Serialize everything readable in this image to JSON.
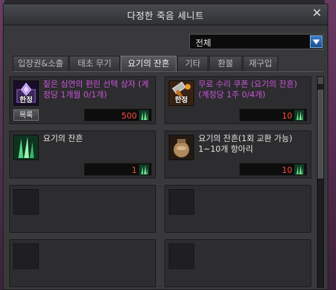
{
  "window": {
    "title": "다정한 죽음 세니트",
    "close_icon": "close-icon"
  },
  "filter": {
    "selected": "전체",
    "dropdown_icon": "chevron-down-icon"
  },
  "tabs": [
    {
      "label": "입장권&소출",
      "active": false
    },
    {
      "label": "태초 무기",
      "active": false
    },
    {
      "label": "요기의 잔흔",
      "active": true
    },
    {
      "label": "기타",
      "active": false
    },
    {
      "label": "환불",
      "active": false
    },
    {
      "label": "재구입",
      "active": false
    }
  ],
  "items": [
    {
      "name": "짙은 심연의 편린 선택 상자 (계정당 1개월 0/1개)",
      "name_color": "#cc55dd",
      "price": "500",
      "price_color": "#ff4a3a",
      "badge": "한정",
      "list_button": "목록",
      "icon": "purple-crystal-box-icon"
    },
    {
      "name": "무료 수리 쿠폰 (요기의 잔흔) (계정당 1주 0/4개)",
      "name_color": "#cc55dd",
      "price": "10",
      "price_color": "#ff4a3a",
      "badge": "한정",
      "icon": "repair-hammer-icon"
    },
    {
      "name": "요기의 잔흔",
      "name_color": "#e6e6e6",
      "price": "1",
      "price_color": "#ff4a3a",
      "icon": "green-shard-icon"
    },
    {
      "name": "요기의 잔흔(1회 교환 가능) 1~10개 항아리",
      "name_color": "#e6e6e6",
      "price": "10",
      "price_color": "#ff4a3a",
      "icon": "jar-icon"
    }
  ],
  "currency_icon": "green-shard-icon",
  "colors": {
    "window_bg": "#39393b",
    "card_bg": "#2d2d2f",
    "purple_text": "#cc55dd",
    "price_red": "#ff4a3a"
  }
}
